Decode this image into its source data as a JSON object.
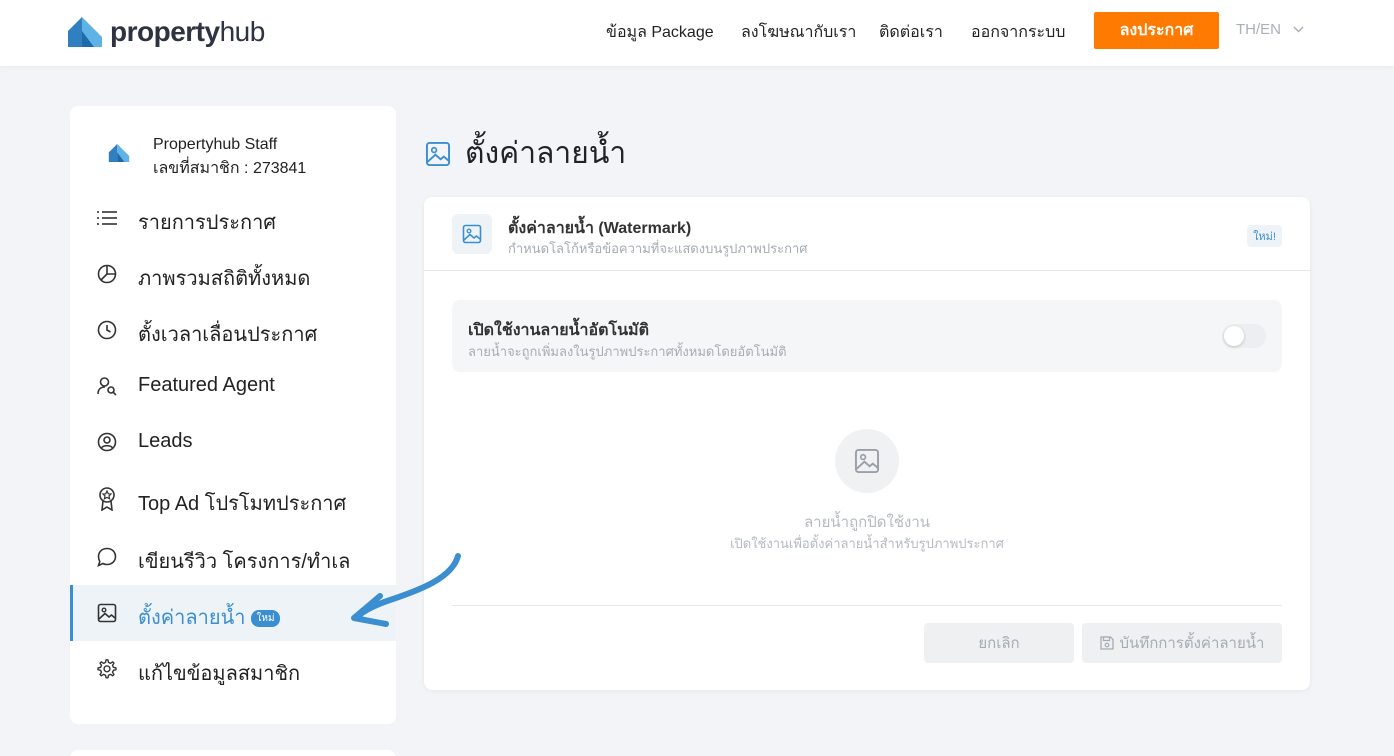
{
  "header": {
    "logo_bold": "property",
    "logo_light": "hub",
    "nav": [
      {
        "label": "ข้อมูล Package",
        "left": 0
      },
      {
        "label": "ลงโฆษณากับเรา"
      },
      {
        "label": "ติดต่อเรา"
      },
      {
        "label": "ออกจากระบบ"
      }
    ],
    "post_button": "ลงประกาศ",
    "lang": "TH/EN"
  },
  "profile": {
    "name": "Propertyhub Staff",
    "member_id": "เลขที่สมาชิก : 273841"
  },
  "sidebar": {
    "items": [
      {
        "label": "รายการประกาศ",
        "icon": "list-icon"
      },
      {
        "label": "ภาพรวมสถิติทั้งหมด",
        "icon": "pie-chart-icon"
      },
      {
        "label": "ตั้งเวลาเลื่อนประกาศ",
        "icon": "clock-icon"
      },
      {
        "label": "Featured Agent",
        "icon": "user-search-icon"
      },
      {
        "label": "Leads",
        "icon": "user-circle-icon"
      },
      {
        "label": "Top Ad โปรโมทประกาศ",
        "icon": "award-icon"
      },
      {
        "label": "เขียนรีวิว โครงการ/ทำเล",
        "icon": "chat-bubble-icon"
      },
      {
        "label": "ตั้งค่าลายน้ำ",
        "icon": "image-icon",
        "badge": "ใหม่"
      },
      {
        "label": "แก้ไขข้อมูลสมาชิก",
        "icon": "gear-icon"
      }
    ]
  },
  "main": {
    "page_title": "ตั้งค่าลายน้ำ",
    "card": {
      "title": "ตั้งค่าลายน้ำ (Watermark)",
      "subtitle": "กำหนดโลโก้หรือข้อความที่จะแสดงบนรูปภาพประกาศ",
      "badge": "ใหม่!",
      "toggle_title": "เปิดใช้งานลายน้ำอัตโนมัติ",
      "toggle_subtitle": "ลายน้ำจะถูกเพิ่มลงในรูปภาพประกาศทั้งหมดโดยอัตโนมัติ",
      "empty_title": "ลายน้ำถูกปิดใช้งาน",
      "empty_subtitle": "เปิดใช้งานเพื่อตั้งค่าลายน้ำสำหรับรูปภาพประกาศ",
      "cancel_label": "ยกเลิก",
      "save_label": "บันทึกการตั้งค่าลายน้ำ"
    }
  },
  "colors": {
    "accent": "#3b8fd0",
    "cta": "#ff7a00"
  }
}
